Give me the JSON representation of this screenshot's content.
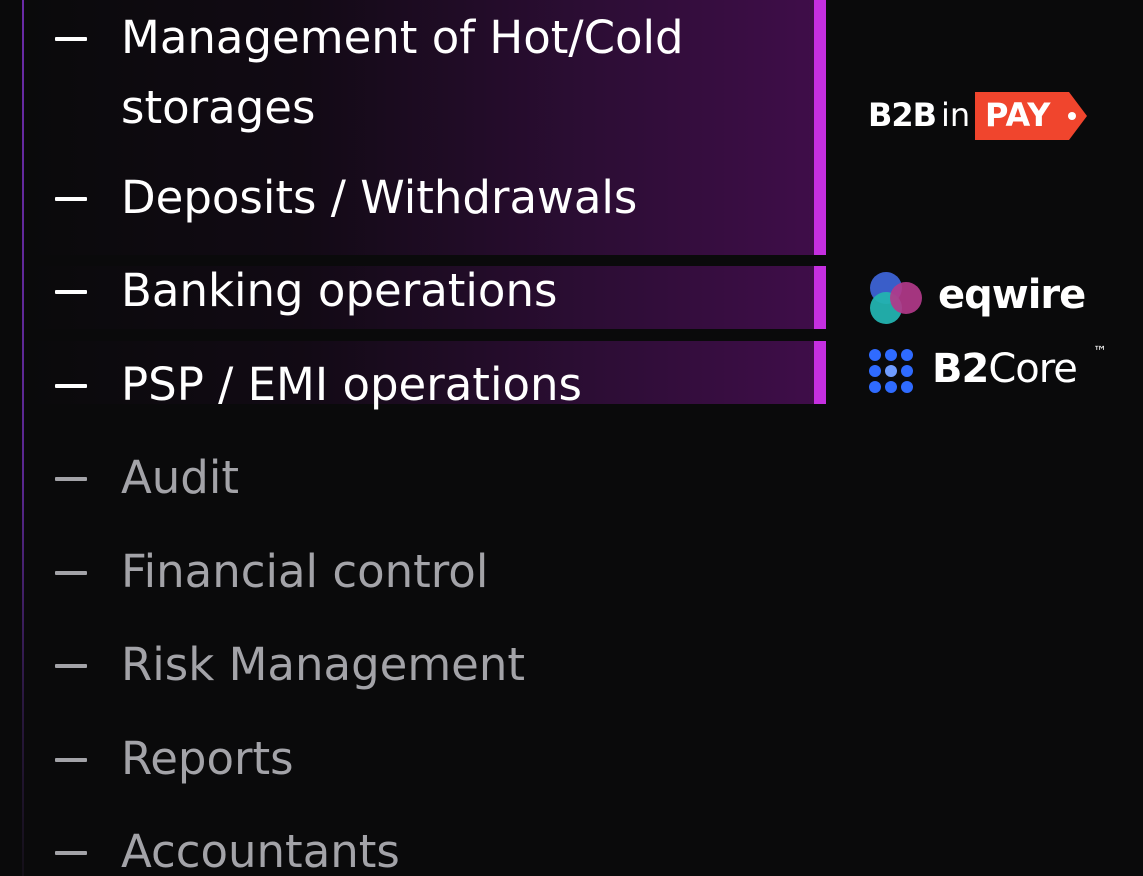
{
  "menu": {
    "items": [
      {
        "line1": "Management of Hot/Cold",
        "line2": "storages",
        "highlighted": true
      },
      {
        "label": "Deposits / Withdrawals",
        "highlighted": true
      },
      {
        "label": "Banking operations",
        "highlighted": true
      },
      {
        "label": "PSP / EMI operations",
        "highlighted": true
      },
      {
        "label": "Audit",
        "highlighted": false
      },
      {
        "label": "Financial control",
        "highlighted": false
      },
      {
        "label": "Risk Management",
        "highlighted": false
      },
      {
        "label": "Reports",
        "highlighted": false
      },
      {
        "label": "Accountants",
        "highlighted": false
      }
    ]
  },
  "logos": {
    "b2binpay": {
      "part1": "B2B",
      "part2": "in",
      "part3": "PAY",
      "icon": "b2binpay-logo"
    },
    "eqwire": {
      "name": "eqwire",
      "icon": "eqwire-logo"
    },
    "b2core": {
      "name_bold": "B2",
      "name_regular": "Core",
      "trademark": "™",
      "icon": "b2core-logo"
    }
  },
  "colors": {
    "background": "#0a0a0b",
    "accent": "#c52fe0",
    "text_highlighted": "#ffffff",
    "text_dimmed": "#a3a3a8",
    "pay_badge": "#f0452d"
  }
}
